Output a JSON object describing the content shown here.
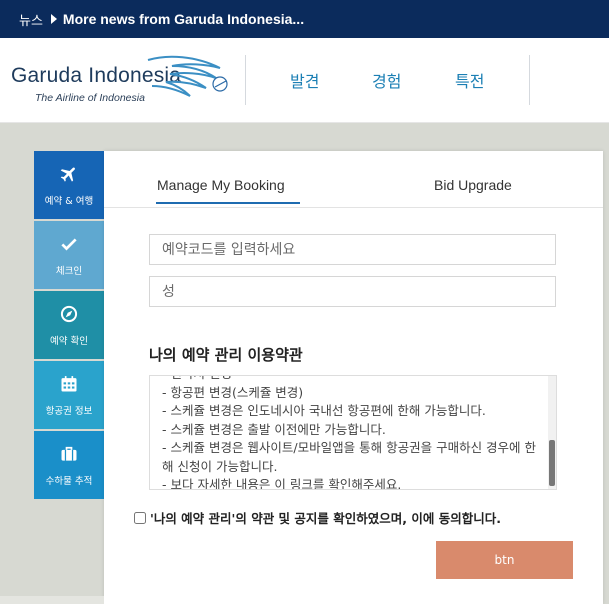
{
  "news": {
    "label": "뉴스",
    "text": "More news from Garuda Indonesia..."
  },
  "header": {
    "brand": "Garuda Indonesia",
    "tagline": "The Airline of Indonesia",
    "nav": [
      "발견",
      "경험",
      "특전"
    ]
  },
  "side_tabs": [
    {
      "label": "예약 & 여행",
      "icon": "airplane-icon",
      "color": "#1665b5"
    },
    {
      "label": "체크인",
      "icon": "check-icon",
      "color": "#5fa8d0"
    },
    {
      "label": "예약 확인",
      "icon": "compass-icon",
      "color": "#1f8fa6"
    },
    {
      "label": "항공권 정보",
      "icon": "calendar-icon",
      "color": "#2aa3cc"
    },
    {
      "label": "수하물 추적",
      "icon": "suitcase-icon",
      "color": "#1a8fc9"
    }
  ],
  "booking": {
    "tabs": [
      "Manage My Booking",
      "Bid Upgrade"
    ],
    "code_placeholder": "예약코드를 입력하세요",
    "lastname_placeholder": "성",
    "terms_title": "나의 예약 관리 이용약관",
    "terms_lines": [
      "- 연락처 변경",
      "- 항공편 변경(스케쥴 변경)",
      "- 스케쥴 변경은 인도네시아 국내선 항공편에 한해 가능합니다.",
      "- 스케쥴 변경은 출발 이전에만 가능합니다.",
      "- 스케쥴 변경은 웹사이트/모바일앱을 통해 항공권을 구매하신 경우에 한해 신청이 가능합니다.",
      "- 보다 자세한 내용은 이 링크를 확인해주세요."
    ],
    "agree_text": "'나의 예약 관리'의 약관 및 공지를 확인하였으며, 이에 동의합니다.",
    "submit_label": "btn"
  },
  "colors": {
    "navy": "#0b2b5c",
    "accent_blue": "#1e6bb0",
    "button": "#d98a6c"
  }
}
